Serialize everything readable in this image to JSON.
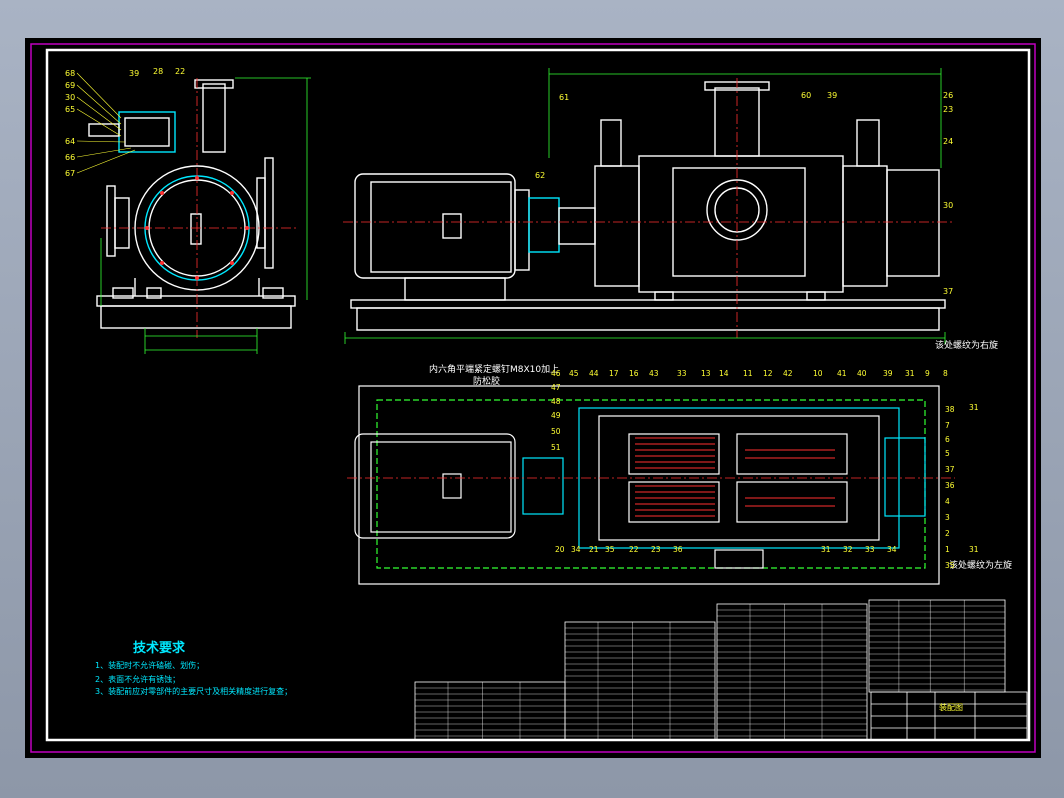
{
  "drawing": {
    "tech_title": "技术要求",
    "tech_notes": [
      "1、装配时不允许磕碰、划伤；",
      "2、表面不允许有锈蚀；",
      "3、装配前应对零部件的主要尺寸及相关精度进行复查；"
    ],
    "annotation_top": "内六角平端紧定螺钉M8X10加上",
    "annotation_top2": "防松胶",
    "annotation_right_top": "该处螺纹为右旋",
    "annotation_right_bottom": "该处螺纹为左旋",
    "title_block_name": "装配图",
    "side_view_labels": [
      "68",
      "39",
      "28",
      "22",
      "69",
      "30",
      "65",
      "64",
      "66",
      "67"
    ],
    "front_view_labels_left": [
      "61",
      "62"
    ],
    "front_view_labels_right": [
      "60",
      "39",
      "26",
      "23",
      "24",
      "30",
      "37"
    ],
    "section_top_labels": [
      "46",
      "45",
      "44",
      "17",
      "16",
      "43",
      "33",
      "13",
      "14",
      "11",
      "12",
      "42",
      "10",
      "41",
      "40",
      "39",
      "31",
      "9",
      "8"
    ],
    "section_left_labels": [
      "47",
      "48",
      "49",
      "50",
      "51"
    ],
    "section_right_labels": [
      "31",
      "38",
      "7",
      "6",
      "5",
      "37",
      "36",
      "4",
      "3",
      "2",
      "1"
    ],
    "section_bottom_labels": [
      "20",
      "34",
      "21",
      "35",
      "22",
      "23",
      "36",
      "31",
      "32",
      "33",
      "34",
      "35",
      "31"
    ]
  },
  "colors": {
    "background": "#000000",
    "outline": "#ffffff",
    "centerline": "#ff3030",
    "dimension": "#33ff33",
    "section_fill": "#00e8ff",
    "text_yellow": "#ffff33",
    "border_magenta": "#c000c0"
  }
}
